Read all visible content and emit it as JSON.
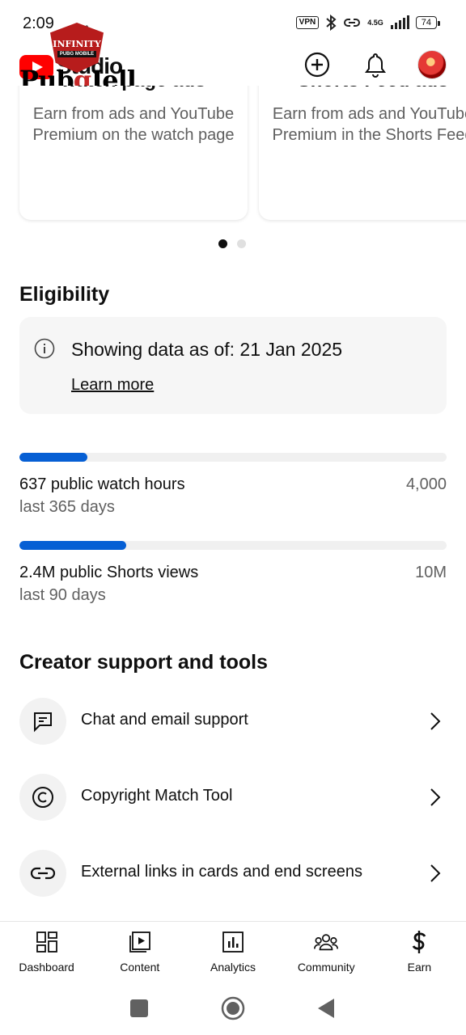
{
  "status_bar": {
    "time": "2:09",
    "dots": "• • •",
    "vpn": "VPN",
    "network": "4.5G",
    "battery": "74"
  },
  "header": {
    "brand": "Studio",
    "overlay_prefix": "Pub",
    "overlay_red": "g",
    "overlay_suffix": "Jell",
    "badge_line1": "INFINITY",
    "badge_line2": "PUBG MOBILE",
    "icons": [
      "create-icon",
      "notifications-icon",
      "avatar"
    ]
  },
  "carousel": {
    "cards": [
      {
        "title": "watch page ads",
        "description": "Earn from ads and YouTube Premium on the watch page"
      },
      {
        "title": "Shorts Feed ads",
        "description": "Earn from ads and YouTube Premium in the Shorts Feed"
      }
    ],
    "active_index": 0,
    "count": 2
  },
  "eligibility": {
    "title": "Eligibility",
    "info_text": "Showing data as of: 21 Jan 2025",
    "learn_more": "Learn more",
    "metrics": [
      {
        "label": "637 public watch hours",
        "sub": "last 365 days",
        "target": "4,000",
        "progress": 0.16
      },
      {
        "label": "2.4M public Shorts views",
        "sub": "last 90 days",
        "target": "10M",
        "progress": 0.25
      }
    ]
  },
  "tools": {
    "title": "Creator support and tools",
    "items": [
      {
        "label": "Chat and email support",
        "icon": "chat-icon"
      },
      {
        "label": "Copyright Match Tool",
        "icon": "copyright-icon"
      },
      {
        "label": "External links in cards and end screens",
        "icon": "link-icon"
      }
    ]
  },
  "bottom_nav": {
    "items": [
      {
        "label": "Dashboard",
        "icon": "dashboard-icon"
      },
      {
        "label": "Content",
        "icon": "content-icon"
      },
      {
        "label": "Analytics",
        "icon": "analytics-icon"
      },
      {
        "label": "Community",
        "icon": "community-icon"
      },
      {
        "label": "Earn",
        "icon": "earn-icon"
      }
    ],
    "active": "Earn"
  },
  "colors": {
    "progress_fill": "#065fd4",
    "track": "#f0f0f0",
    "brand_red": "#ff0000"
  }
}
